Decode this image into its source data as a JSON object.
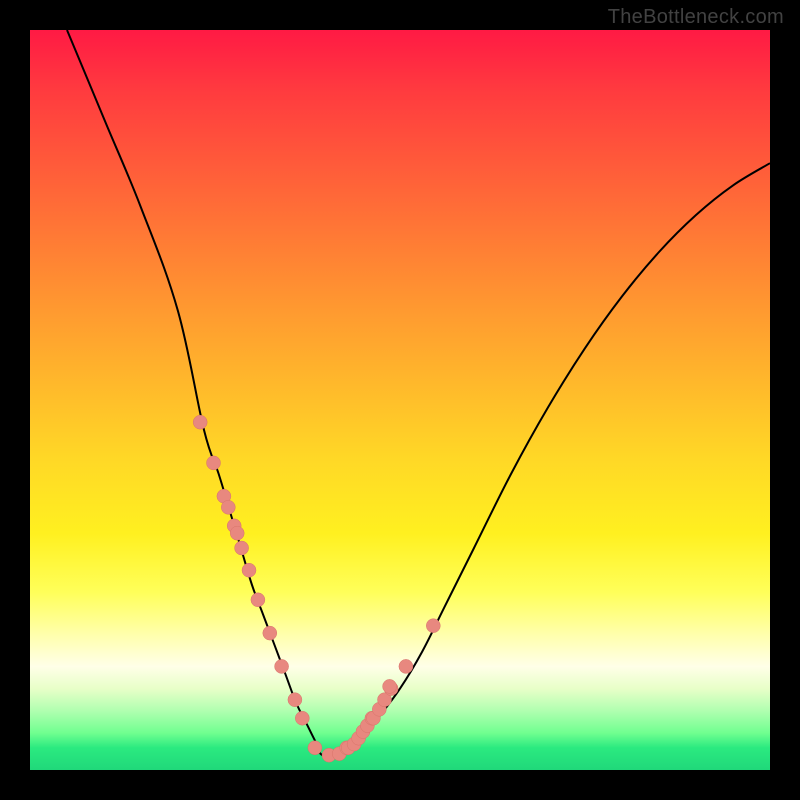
{
  "watermark": "TheBottleneck.com",
  "colors": {
    "frame_bg_top": "#ff1a44",
    "frame_bg_bottom": "#20d87a",
    "border": "#000000",
    "curve": "#000000",
    "dots": "#e8887f"
  },
  "chart_data": {
    "type": "line",
    "title": "",
    "xlabel": "",
    "ylabel": "",
    "xlim": [
      0,
      100
    ],
    "ylim": [
      0,
      100
    ],
    "note": "Inferred V-shaped bottleneck/compatibility curve. y=0 is best (green). No axis ticks shown; x/y are normalized percentages of plot width/height.",
    "series": [
      {
        "name": "bottleneck-curve",
        "x": [
          5,
          10,
          15,
          20,
          23.5,
          25.5,
          27,
          28.5,
          30,
          31.5,
          33,
          34.5,
          36,
          37.5,
          38.5,
          39.5,
          42,
          44.5,
          47,
          50,
          53,
          56,
          60,
          65,
          70,
          75,
          80,
          85,
          90,
          95,
          100
        ],
        "y": [
          100,
          88,
          76,
          62,
          46,
          40,
          35,
          30,
          25,
          21,
          17,
          13,
          9,
          6,
          4,
          2,
          2,
          4,
          7,
          11,
          16,
          22,
          30,
          40,
          49,
          57,
          64,
          70,
          75,
          79,
          82
        ]
      }
    ],
    "marker_points": {
      "name": "sample-dots",
      "x": [
        23.0,
        24.8,
        26.2,
        26.8,
        27.6,
        28.0,
        28.6,
        29.6,
        30.8,
        32.4,
        34.0,
        35.8,
        36.8,
        38.5,
        40.4,
        41.8,
        42.8,
        43.0,
        43.8,
        44.4,
        45.0,
        45.6,
        46.2,
        46.4,
        47.2,
        47.9,
        48.8,
        50.8,
        48.6,
        54.5
      ],
      "y": [
        47.0,
        41.5,
        37.0,
        35.5,
        33.0,
        32.0,
        30.0,
        27.0,
        23.0,
        18.5,
        14.0,
        9.5,
        7.0,
        3.0,
        2.0,
        2.2,
        3.0,
        3.0,
        3.5,
        4.3,
        5.2,
        6.0,
        7.0,
        7.0,
        8.2,
        9.5,
        11.0,
        14.0,
        11.3,
        19.5
      ]
    }
  }
}
